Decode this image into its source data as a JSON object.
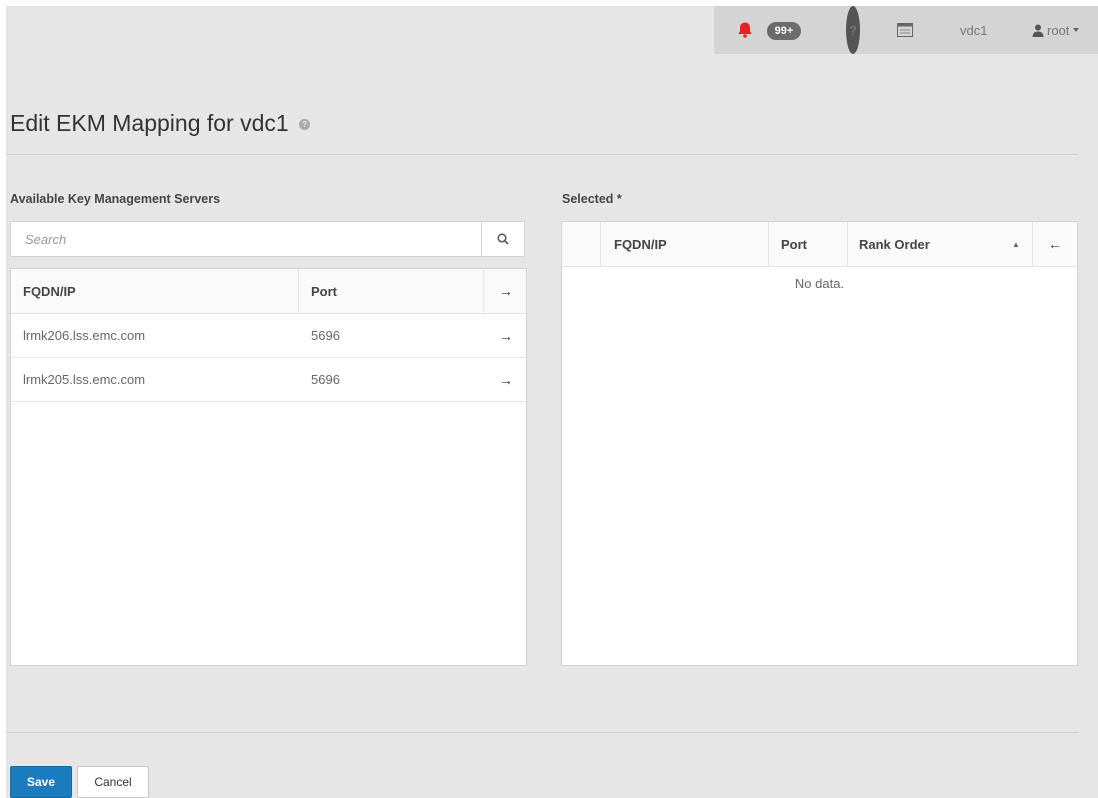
{
  "topbar": {
    "notification_count": "99+",
    "vdc_label": "vdc1",
    "user_label": "root"
  },
  "page": {
    "title": "Edit EKM Mapping for vdc1"
  },
  "available": {
    "label": "Available Key Management Servers",
    "search_placeholder": "Search",
    "columns": {
      "fqdn": "FQDN/IP",
      "port": "Port"
    },
    "rows": [
      {
        "fqdn": "lrmk206.lss.emc.com",
        "port": "5696"
      },
      {
        "fqdn": "lrmk205.lss.emc.com",
        "port": "5696"
      }
    ]
  },
  "selected": {
    "label": "Selected *",
    "columns": {
      "fqdn": "FQDN/IP",
      "port": "Port",
      "rank": "Rank Order"
    },
    "empty_text": "No data."
  },
  "actions": {
    "save_label": "Save",
    "cancel_label": "Cancel"
  },
  "colors": {
    "accent": "#1b7bbf",
    "bell": "#e52222"
  }
}
